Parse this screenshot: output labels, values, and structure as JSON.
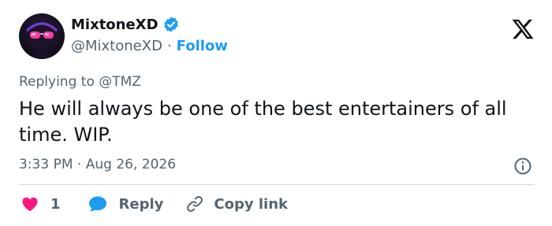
{
  "author": {
    "display_name": "MixtoneXD",
    "handle": "@MixtoneXD",
    "separator": "·",
    "follow_label": "Follow"
  },
  "tweet": {
    "reply_context": "Replying to @TMZ",
    "text": "He will always be one of the best entertainers of all time. WIP.",
    "time": "3:33 PM",
    "date_separator": "·",
    "date": "Aug 26, 2026"
  },
  "actions": {
    "like_count": "1",
    "reply_label": "Reply",
    "copy_link_label": "Copy link"
  },
  "colors": {
    "accent": "#1d9bf0",
    "like": "#f91880",
    "muted": "#536471",
    "text": "#0f1419"
  },
  "icons": {
    "verified": "verified-badge-icon",
    "logo": "x-logo-icon",
    "info": "info-icon",
    "like": "heart-icon",
    "reply": "speech-bubble-icon",
    "copy": "link-icon"
  }
}
